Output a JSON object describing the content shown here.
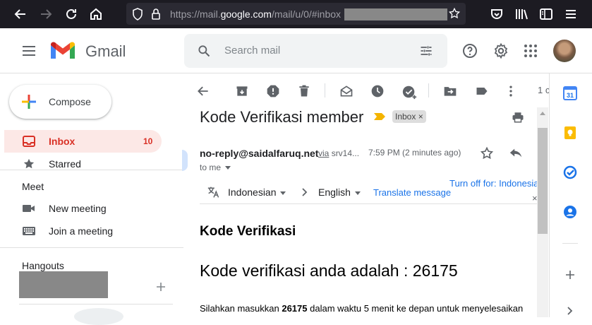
{
  "browser": {
    "url_prefix": "https://mail.",
    "url_domain": "google.com",
    "url_path": "/mail/u/0/#inbox"
  },
  "gmail": {
    "logo_text": "Gmail",
    "search_placeholder": "Search mail"
  },
  "sidebar": {
    "compose_label": "Compose",
    "inbox_label": "Inbox",
    "inbox_count": "10",
    "starred_label": "Starred",
    "meet_heading": "Meet",
    "new_meeting_label": "New meeting",
    "join_meeting_label": "Join a meeting",
    "hangouts_heading": "Hangouts"
  },
  "toolbar": {
    "pager_fragment": "1 c"
  },
  "message": {
    "subject": "Kode Verifikasi member",
    "label_chip": "Inbox",
    "label_chip_close": "×",
    "sender": "no-reply@saidalfaruq.net",
    "via_label": "via",
    "via_domain": "srv14...",
    "time": "7:59 PM (2 minutes ago)",
    "to": "to me",
    "translate": {
      "from_lang": "Indonesian",
      "to_lang": "English",
      "translate_link": "Translate message",
      "turn_off": "Turn off for: Indonesia",
      "close": "×"
    },
    "body": {
      "heading": "Kode Verifikasi",
      "code_line": "Kode verifikasi anda adalah : 26175",
      "para_pre": "Silahkan masukkan ",
      "para_code": "26175",
      "para_post": " dalam waktu 5 menit ke depan untuk menyelesaikan"
    }
  },
  "colors": {
    "inbox_active_bg": "#fce8e6",
    "inbox_active_text": "#d93025",
    "link_blue": "#1a73e8",
    "important_marker": "#f4b400"
  }
}
